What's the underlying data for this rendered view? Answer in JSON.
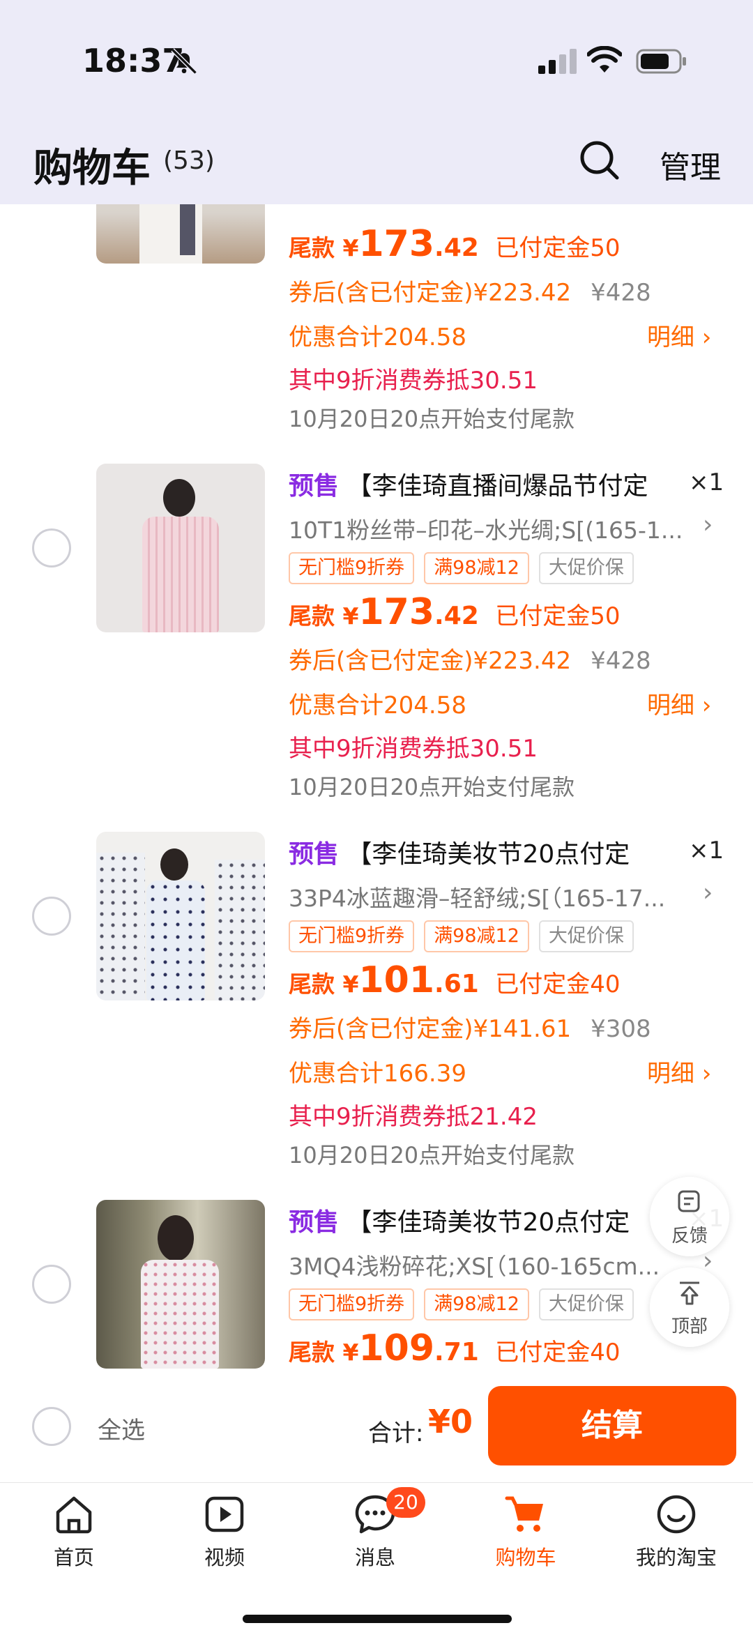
{
  "status": {
    "time": "18:37"
  },
  "header": {
    "title": "购物车",
    "count": "(53)",
    "manage_label": "管理"
  },
  "products": [
    {
      "presale": "",
      "name": "",
      "qty": "",
      "spec": "",
      "tags": [],
      "balance_label": "尾款",
      "currency": "¥",
      "balance_int": "173",
      "balance_dec": ".42",
      "paid": "已付定金50",
      "after_coupon": "券后(含已付定金)¥223.42",
      "original": "¥428",
      "discount_total": "优惠合计204.58",
      "detail_label": "明细 ›",
      "coupon_note": "其中9折消费券抵30.51",
      "pay_time": "10月20日20点开始支付尾款"
    },
    {
      "presale": "预售",
      "name": "【李佳琦直播间爆品节付定",
      "qty": "×1",
      "spec": "10T1粉丝带–印花–水光绸;S[(165-1...",
      "tags": [
        "无门槛9折券",
        "满98减12",
        "大促价保"
      ],
      "balance_label": "尾款",
      "currency": "¥",
      "balance_int": "173",
      "balance_dec": ".42",
      "paid": "已付定金50",
      "after_coupon": "券后(含已付定金)¥223.42",
      "original": "¥428",
      "discount_total": "优惠合计204.58",
      "detail_label": "明细 ›",
      "coupon_note": "其中9折消费券抵30.51",
      "pay_time": "10月20日20点开始支付尾款"
    },
    {
      "presale": "预售",
      "name": "【李佳琦美妆节20点付定",
      "qty": "×1",
      "spec": "33P4冰蓝趣滑–轻舒绒;S[（165-17...",
      "tags": [
        "无门槛9折券",
        "满98减12",
        "大促价保"
      ],
      "balance_label": "尾款",
      "currency": "¥",
      "balance_int": "101",
      "balance_dec": ".61",
      "paid": "已付定金40",
      "after_coupon": "券后(含已付定金)¥141.61",
      "original": "¥308",
      "discount_total": "优惠合计166.39",
      "detail_label": "明细 ›",
      "coupon_note": "其中9折消费券抵21.42",
      "pay_time": "10月20日20点开始支付尾款"
    },
    {
      "presale": "预售",
      "name": "【李佳琦美妆节20点付定",
      "qty": "×1",
      "spec": "3MQ4浅粉碎花;XS[（160-165cm...",
      "tags": [
        "无门槛9折券",
        "满98减12",
        "大促价保"
      ],
      "balance_label": "尾款",
      "currency": "¥",
      "balance_int": "109",
      "balance_dec": ".71",
      "paid": "已付定金40"
    }
  ],
  "floating": {
    "feedback": "反馈",
    "top": "顶部"
  },
  "checkout": {
    "select_all": "全选",
    "total_label": "合计:",
    "total_value": "¥0",
    "pay_label": "结算"
  },
  "tabs": [
    {
      "label": "首页",
      "icon": "home-icon"
    },
    {
      "label": "视频",
      "icon": "video-icon"
    },
    {
      "label": "消息",
      "icon": "message-icon",
      "badge": "20"
    },
    {
      "label": "购物车",
      "icon": "cart-icon",
      "active": true
    },
    {
      "label": "我的淘宝",
      "icon": "profile-icon"
    }
  ],
  "colors": {
    "accent": "#ff5000",
    "presale": "#8a2be2",
    "coupon": "#e8204d",
    "header_bg": "#ecebf8"
  }
}
